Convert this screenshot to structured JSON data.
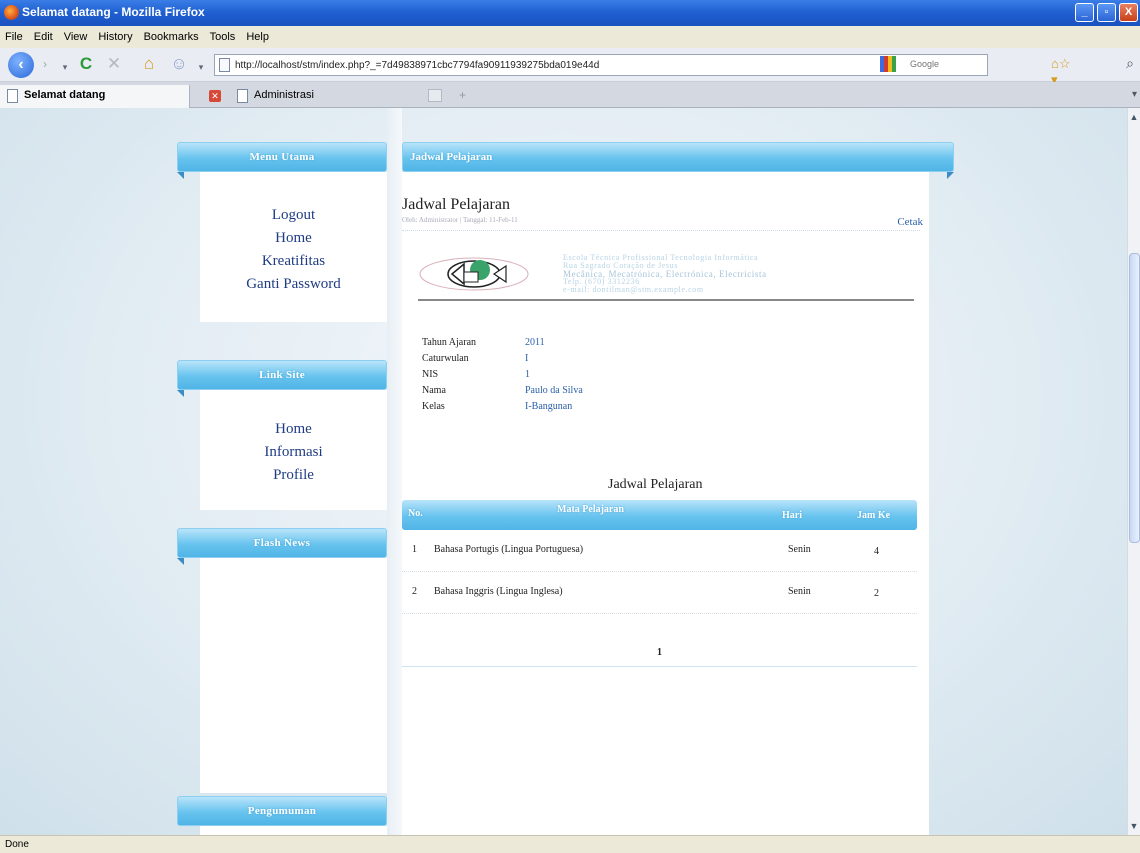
{
  "window": {
    "title": "Selamat datang - Mozilla Firefox",
    "controls": [
      "_",
      "▫",
      "X"
    ]
  },
  "menu": [
    "File",
    "Edit",
    "View",
    "History",
    "Bookmarks",
    "Tools",
    "Help"
  ],
  "toolbar": {
    "url": "http://localhost/stm/index.php?_=7d49838971cbc7794fa90911939275bda019e44d",
    "search_placeholder": "Google"
  },
  "tabs": {
    "active": "Selamat datang",
    "inactive": "Administrasi"
  },
  "sidebar": {
    "menu_utama": {
      "header": "Menu Utama",
      "links": [
        "Logout",
        "Home",
        "Kreatifitas",
        "Ganti Password"
      ]
    },
    "link_site": {
      "header": "Link Site",
      "links": [
        "Home",
        "Informasi",
        "Profile"
      ]
    },
    "flash_news": {
      "header": "Flash News"
    },
    "pengumuman": {
      "header": "Pengumuman"
    }
  },
  "main": {
    "header": "Jadwal Pelajaran",
    "title": "Jadwal Pelajaran",
    "meta": "Oleh: Administrator | Tanggal: 11-Feb-11",
    "cetak": "Cetak",
    "letterhead_lines": [
      "Escola Técnica Profissional Tecnologia Informática",
      "Rua Sagrado Coração de Jesus",
      "Mecânica, Mecatrónica, Electrónica, Electricista",
      "Telp. (670) 3312236",
      "e-mail: dontilman@stm.example.com"
    ],
    "info": [
      {
        "label": "Tahun Ajaran",
        "value": "2011"
      },
      {
        "label": "Caturwulan",
        "value": "I"
      },
      {
        "label": "NIS",
        "value": "1"
      },
      {
        "label": "Nama",
        "value": "Paulo da Silva"
      },
      {
        "label": "Kelas",
        "value": "I-Bangunan"
      }
    ],
    "schedule_title": "Jadwal Pelajaran",
    "table": {
      "headers": [
        "No.",
        "Mata Pelajaran",
        "Hari",
        "Jam Ke"
      ],
      "rows": [
        [
          "1",
          "Bahasa Portugis (Lingua Portuguesa)",
          "Senin",
          "4"
        ],
        [
          "2",
          "Bahasa Inggris (Lingua Inglesa)",
          "Senin",
          "2"
        ]
      ]
    },
    "pagination": "1"
  },
  "status": {
    "text": "Done"
  }
}
